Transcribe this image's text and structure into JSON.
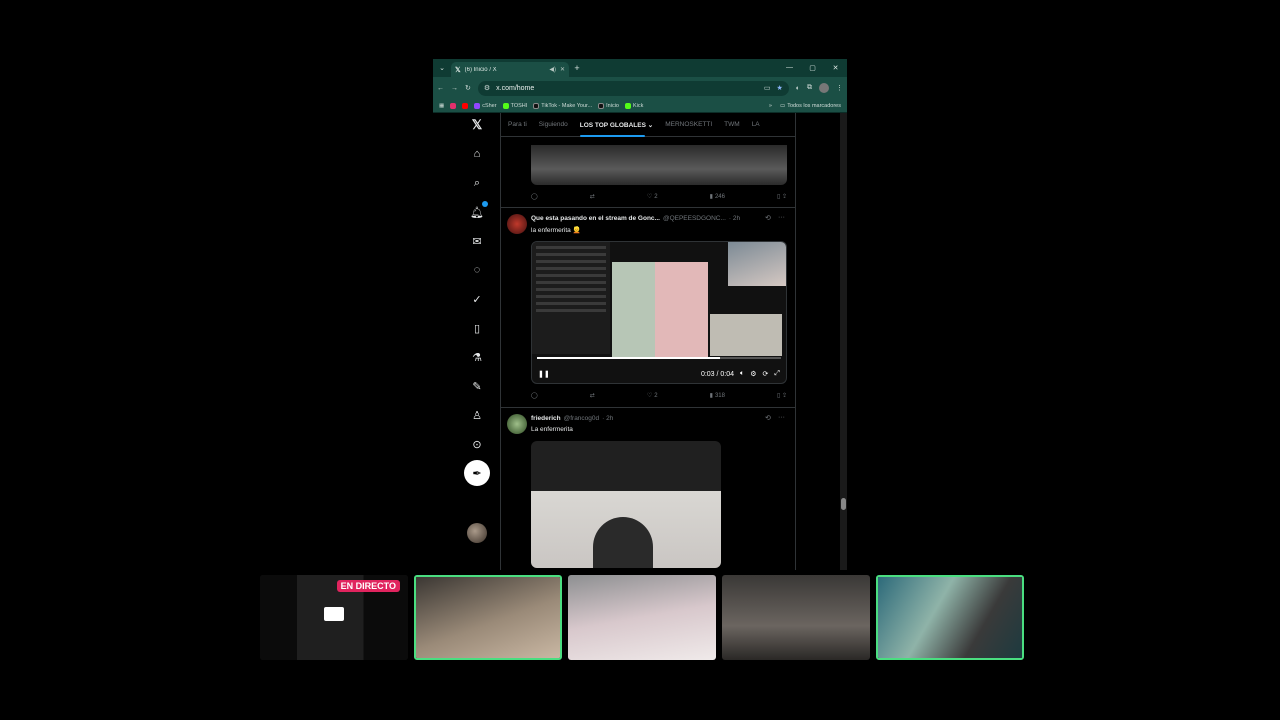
{
  "browser": {
    "tab_title": "(6) Inicio / X",
    "url": "x.com/home",
    "bookmarks": [
      {
        "label": "",
        "color": "#e1306c"
      },
      {
        "label": "",
        "color": "#ff0000"
      },
      {
        "label": "cSher",
        "color": "#9146ff"
      },
      {
        "label": "TOSHI",
        "color": "#53fc18"
      },
      {
        "label": "TikTok - Make Your...",
        "color": "#000000"
      },
      {
        "label": "Inicio",
        "color": "#000000"
      },
      {
        "label": "Kick",
        "color": "#53fc18"
      }
    ],
    "bookmarks_more": "»",
    "all_bookmarks": "Todos los marcadores"
  },
  "x": {
    "tabs": [
      {
        "label": "Para ti",
        "active": false
      },
      {
        "label": "Siguiendo",
        "active": false
      },
      {
        "label": "LOS TOP GLOBALES",
        "active": true
      },
      {
        "label": "MERNOSKETTI",
        "active": false
      },
      {
        "label": "TWM",
        "active": false
      },
      {
        "label": "LA",
        "active": false
      }
    ],
    "sidebar_icons": [
      "x-logo-icon",
      "home-icon",
      "search-icon",
      "bell-icon",
      "mail-icon",
      "grok-icon",
      "verified-icon",
      "bookmark-icon",
      "lab-icon",
      "edit-icon",
      "person-icon",
      "more-circle-icon"
    ],
    "post_button_icon": "feather-icon",
    "prev_tweet_actions": {
      "likes": "2",
      "views": "246"
    },
    "tweet1": {
      "name": "Que esta pasando en el stream de Gonc...",
      "handle": "@QEPEESDGONC...",
      "time": "· 2h",
      "text": "la enfermerita 👱",
      "video_time": "0:03 / 0:04",
      "progress": 0.75,
      "likes": "2",
      "views": "318"
    },
    "tweet2": {
      "name": "friederich",
      "handle": "@francog0d",
      "time": "· 2h",
      "text": "La enfermerita"
    }
  },
  "stream": {
    "live_label": "EN DIRECTO"
  }
}
